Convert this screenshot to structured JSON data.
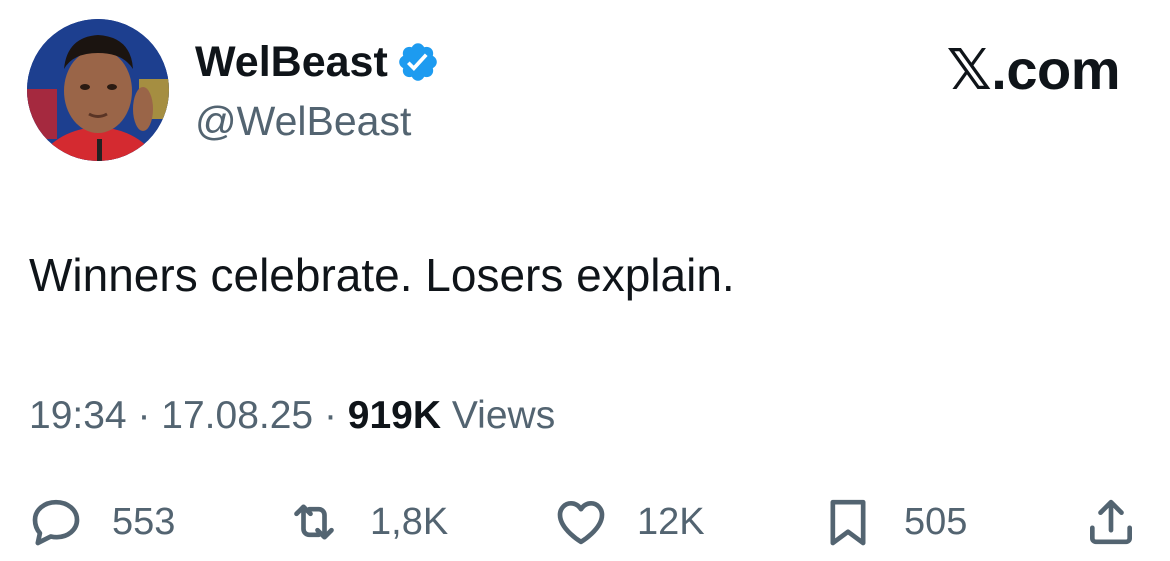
{
  "author": {
    "display_name": "WelBeast",
    "handle": "@WelBeast",
    "verified": true
  },
  "brand": {
    "label": "𝕏.com"
  },
  "tweet": {
    "text": "Winners celebrate. Losers explain.",
    "time": "19:34",
    "separator": "·",
    "date": "17.08.25",
    "views_count": "919K",
    "views_label": "Views"
  },
  "actions": {
    "reply": {
      "icon": "reply-icon",
      "count": "553"
    },
    "retweet": {
      "icon": "retweet-icon",
      "count": "1,8K"
    },
    "like": {
      "icon": "heart-icon",
      "count": "12K"
    },
    "bookmark": {
      "icon": "bookmark-icon",
      "count": "505"
    },
    "share": {
      "icon": "share-icon"
    }
  },
  "colors": {
    "text_primary": "#0f1419",
    "text_secondary": "#536471",
    "verified_blue": "#1d9bf0"
  }
}
